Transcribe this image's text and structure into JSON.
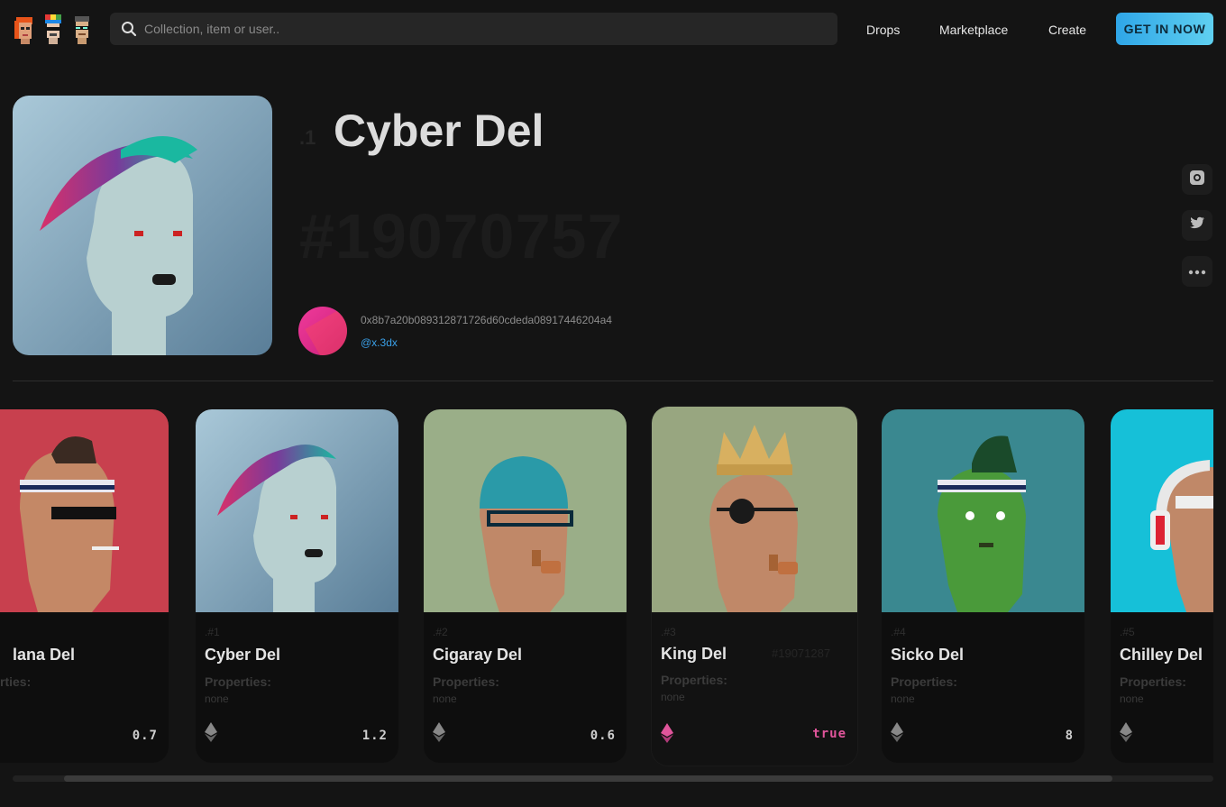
{
  "header": {
    "search_placeholder": "Collection, item or user..",
    "nav": [
      "Drops",
      "Marketplace",
      "Create"
    ],
    "cta_label": "GET IN NOW",
    "accent": "#3aa8e8"
  },
  "hero": {
    "rank": ".1",
    "title": "Cyber Del",
    "token_id": "#19070757",
    "owner_address": "0x8b7a20b089312871726d60cdeda08917446204a4",
    "owner_handle": "@x.3dx"
  },
  "social": [
    "instagram-icon",
    "twitter-icon",
    "more-icon"
  ],
  "cards": [
    {
      "rank": "",
      "name": "lana Del",
      "props_label": "rties:",
      "props_value": "",
      "price": "0.7",
      "icon": "ethereum-icon"
    },
    {
      "rank": ".#1",
      "name": "Cyber Del",
      "props_label": "Properties:",
      "props_value": "none",
      "price": "1.2",
      "icon": "ethereum-icon"
    },
    {
      "rank": ".#2",
      "name": "Cigaray Del",
      "props_label": "Properties:",
      "props_value": "none",
      "price": "0.6",
      "icon": "ethereum-icon"
    },
    {
      "rank": ".#3",
      "name": "King Del",
      "token_id": "#19071287",
      "props_label": "Properties:",
      "props_value": "none",
      "price": "true",
      "icon": "ethereum-icon"
    },
    {
      "rank": ".#4",
      "name": "Sicko Del",
      "props_label": "Properties:",
      "props_value": "none",
      "price": "8",
      "icon": "ethereum-icon"
    },
    {
      "rank": ".#5",
      "name": "Chilley Del",
      "props_label": "Properties:",
      "props_value": "none",
      "price": "",
      "icon": "ethereum-icon"
    }
  ],
  "colors": {
    "featured_price": "#e0559b",
    "handle": "#3aa0e8"
  }
}
